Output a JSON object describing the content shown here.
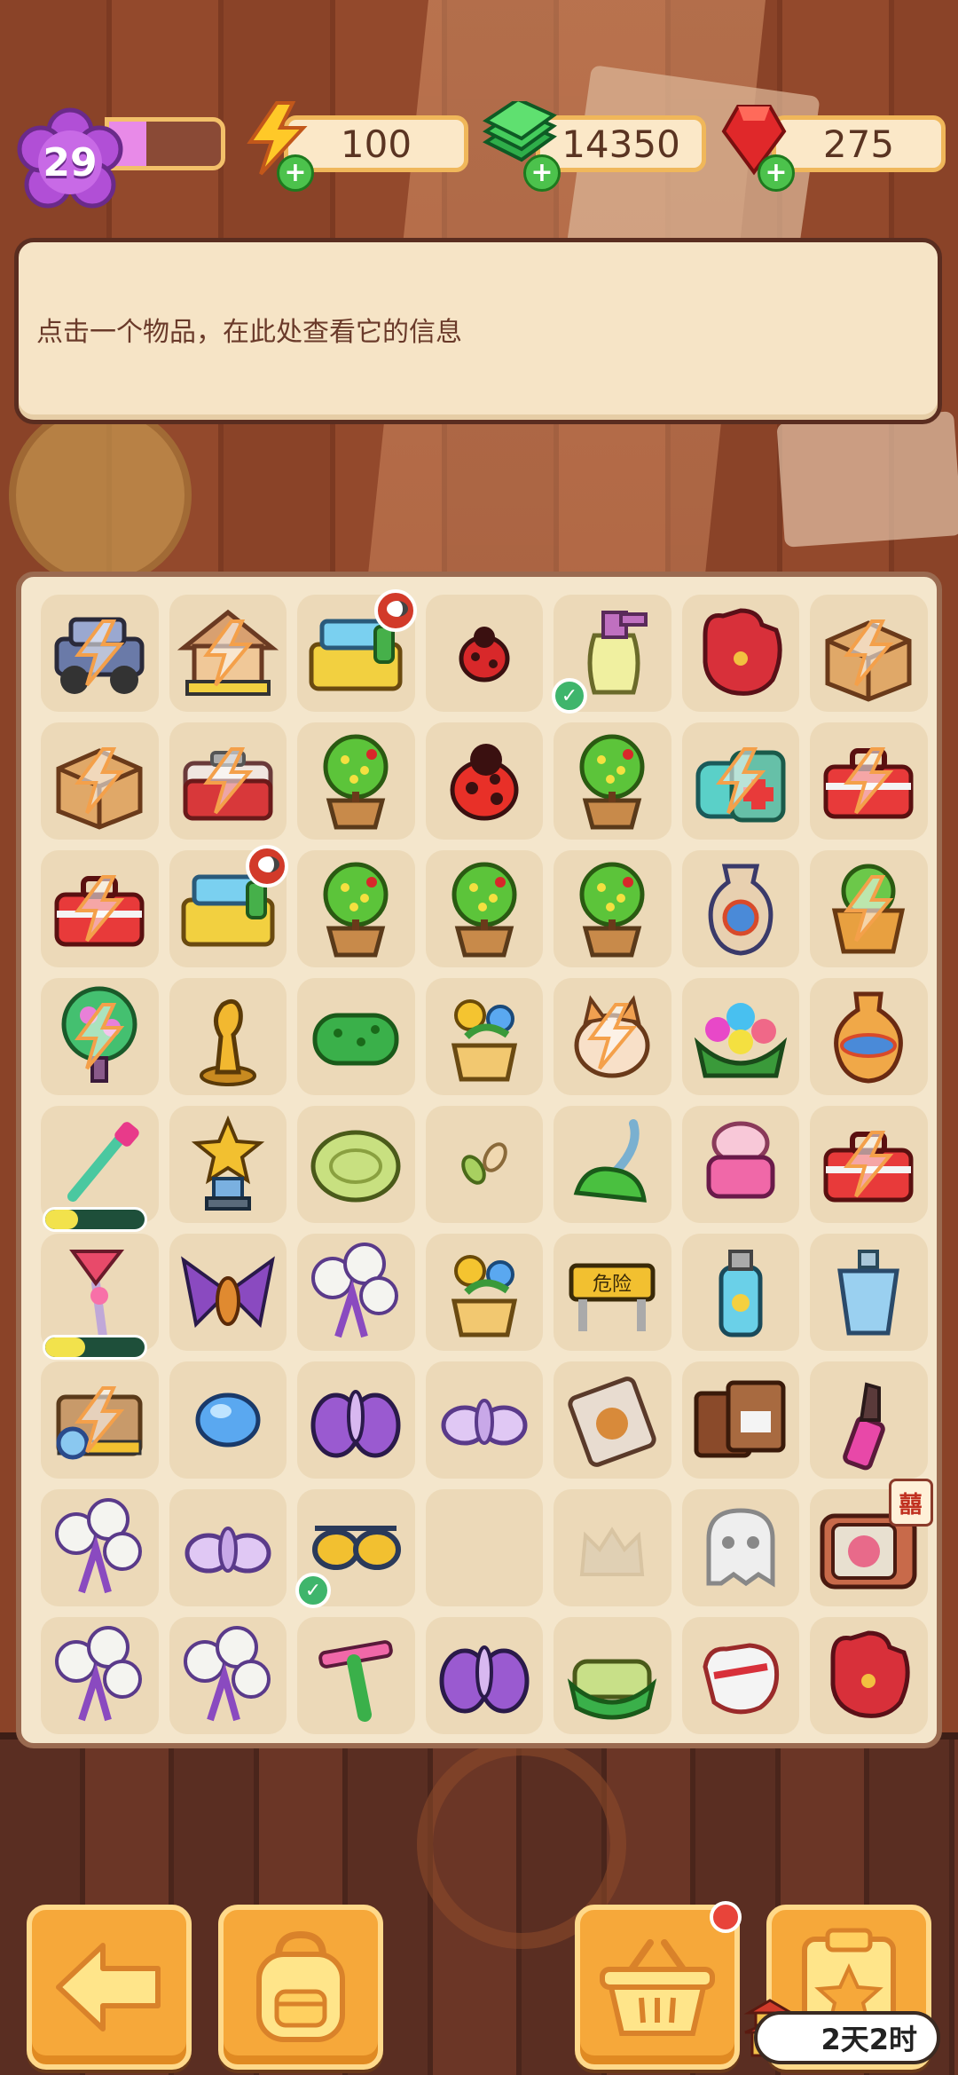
{
  "hud": {
    "level": "29",
    "xp_fraction": 0.33,
    "energy": "100",
    "cash": "14350",
    "gems": "275"
  },
  "info_panel": {
    "text": "点击一个物品，在此处查看它的信息"
  },
  "board": {
    "rows": [
      [
        {
          "item": "jeep-icon",
          "energy": true
        },
        {
          "item": "doghouse-icon",
          "energy": true
        },
        {
          "item": "cleaning-cart-icon",
          "timer": true
        },
        {
          "item": "ladybug-small-icon"
        },
        {
          "item": "spray-bottle-icon",
          "check": true
        },
        {
          "item": "baseball-glove-icon"
        },
        {
          "item": "cardboard-box-icon",
          "energy": true
        }
      ],
      [
        {
          "item": "cardboard-box-icon",
          "energy": true
        },
        {
          "item": "cooler-box-icon",
          "energy": true
        },
        {
          "item": "potted-tree-icon"
        },
        {
          "item": "ladybug-large-icon"
        },
        {
          "item": "potted-tree-icon"
        },
        {
          "item": "first-aid-kit-icon",
          "energy": true
        },
        {
          "item": "toolbox-icon",
          "energy": true
        }
      ],
      [
        {
          "item": "toolbox-icon",
          "energy": true
        },
        {
          "item": "cleaning-cart-icon",
          "timer": true
        },
        {
          "item": "potted-tree-icon"
        },
        {
          "item": "potted-tree-icon"
        },
        {
          "item": "potted-tree-icon"
        },
        {
          "item": "vase-icon"
        },
        {
          "item": "plant-pot-icon",
          "energy": true
        }
      ],
      [
        {
          "item": "blossom-tree-icon",
          "energy": true
        },
        {
          "item": "gold-statue-icon"
        },
        {
          "item": "green-sponge-icon"
        },
        {
          "item": "flower-pot-icon"
        },
        {
          "item": "cat-icon",
          "energy": true
        },
        {
          "item": "flower-basket-icon"
        },
        {
          "item": "urn-icon"
        }
      ],
      [
        {
          "item": "paintbrush-icon",
          "progress": 0.33
        },
        {
          "item": "star-trophy-icon"
        },
        {
          "item": "soap-bar-icon"
        },
        {
          "item": "seeds-icon"
        },
        {
          "item": "vacuum-icon"
        },
        {
          "item": "cream-jar-icon"
        },
        {
          "item": "toolbox-icon",
          "energy": true
        }
      ],
      [
        {
          "item": "feather-duster-icon",
          "progress": 0.4
        },
        {
          "item": "moth-orange-icon"
        },
        {
          "item": "dandelion-icon"
        },
        {
          "item": "flower-pot-icon"
        },
        {
          "item": "danger-barrier-icon"
        },
        {
          "item": "sunscreen-bottle-icon"
        },
        {
          "item": "perfume-bottle-icon"
        }
      ],
      [
        {
          "item": "detective-box-icon",
          "energy": true
        },
        {
          "item": "blue-gem-icon"
        },
        {
          "item": "moth-purple-icon"
        },
        {
          "item": "moth-lilac-icon"
        },
        {
          "item": "evidence-bag-icon"
        },
        {
          "item": "envelopes-icon"
        },
        {
          "item": "lipstick-icon"
        }
      ],
      [
        {
          "item": "dandelion-icon"
        },
        {
          "item": "moth-lilac-icon"
        },
        {
          "item": "sunglasses-icon",
          "check": true
        },
        {
          "item": "empty"
        },
        {
          "item": "locked-slot-icon"
        },
        {
          "item": "ghost-icon"
        },
        {
          "item": "tv-icon",
          "tv_badge": "囍"
        }
      ],
      [
        {
          "item": "dandelion-icon"
        },
        {
          "item": "dandelion-icon"
        },
        {
          "item": "squeegee-icon"
        },
        {
          "item": "moth-purple-icon"
        },
        {
          "item": "green-sponge-tray-icon"
        },
        {
          "item": "glove-white-icon"
        },
        {
          "item": "baseball-glove-icon"
        }
      ]
    ]
  },
  "bottom_bar": {
    "back_icon": "back-arrow-icon",
    "backpack_icon": "backpack-icon",
    "basket_icon": "basket-icon",
    "task_icon": "clipboard-star-icon",
    "event_timer": "2天2时"
  },
  "colors": {
    "button_orange": "#f6a83a",
    "board_bg": "#f4e6cc",
    "panel_bg": "#f6e4c6",
    "notification_red": "#e8443a"
  }
}
